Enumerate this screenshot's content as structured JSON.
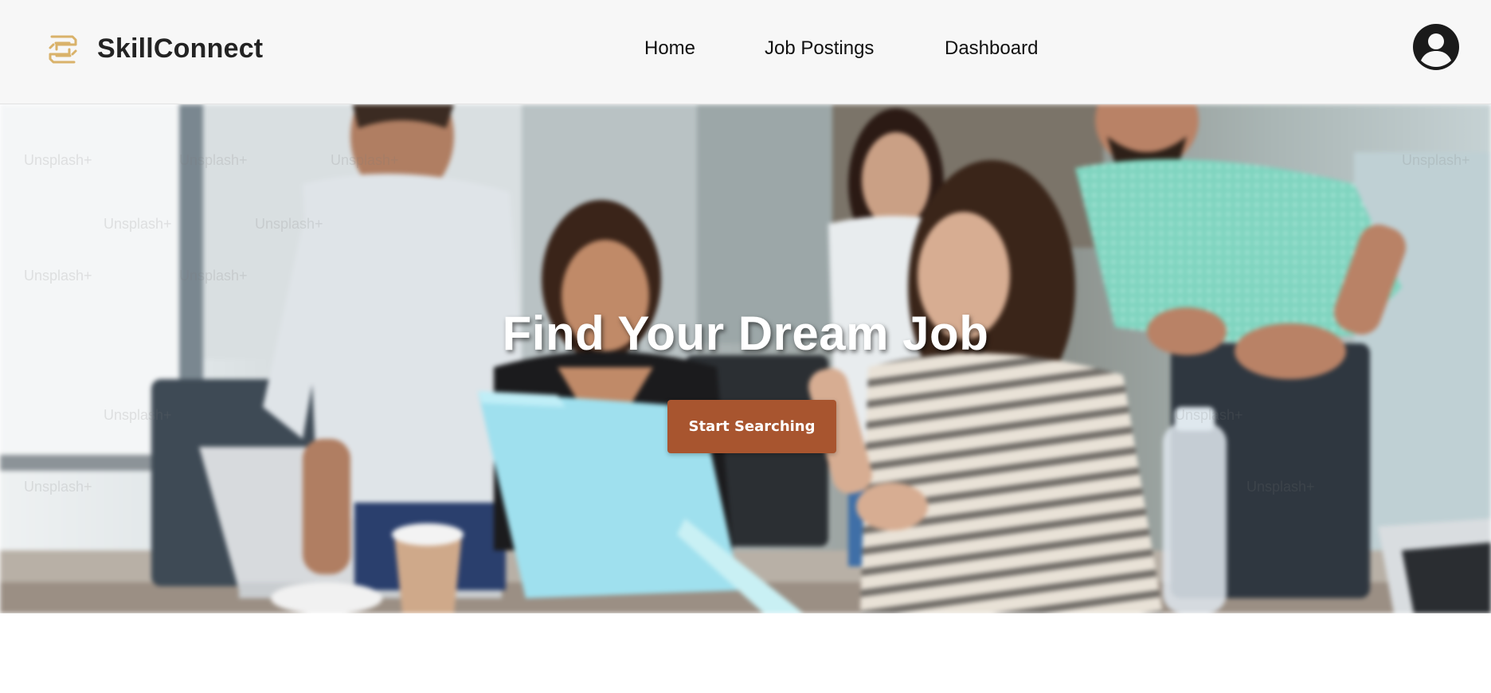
{
  "brand": {
    "name": "SkillConnect",
    "logo_icon": "skillconnect-logo-icon",
    "logo_color": "#d9b26a"
  },
  "nav": {
    "items": [
      {
        "label": "Home"
      },
      {
        "label": "Job Postings"
      },
      {
        "label": "Dashboard"
      }
    ]
  },
  "profile": {
    "icon": "user-avatar-icon"
  },
  "hero": {
    "title": "Find Your Dream Job",
    "cta_label": "Start Searching",
    "cta_color": "#a8552f",
    "watermark_text": "Unsplash+"
  }
}
